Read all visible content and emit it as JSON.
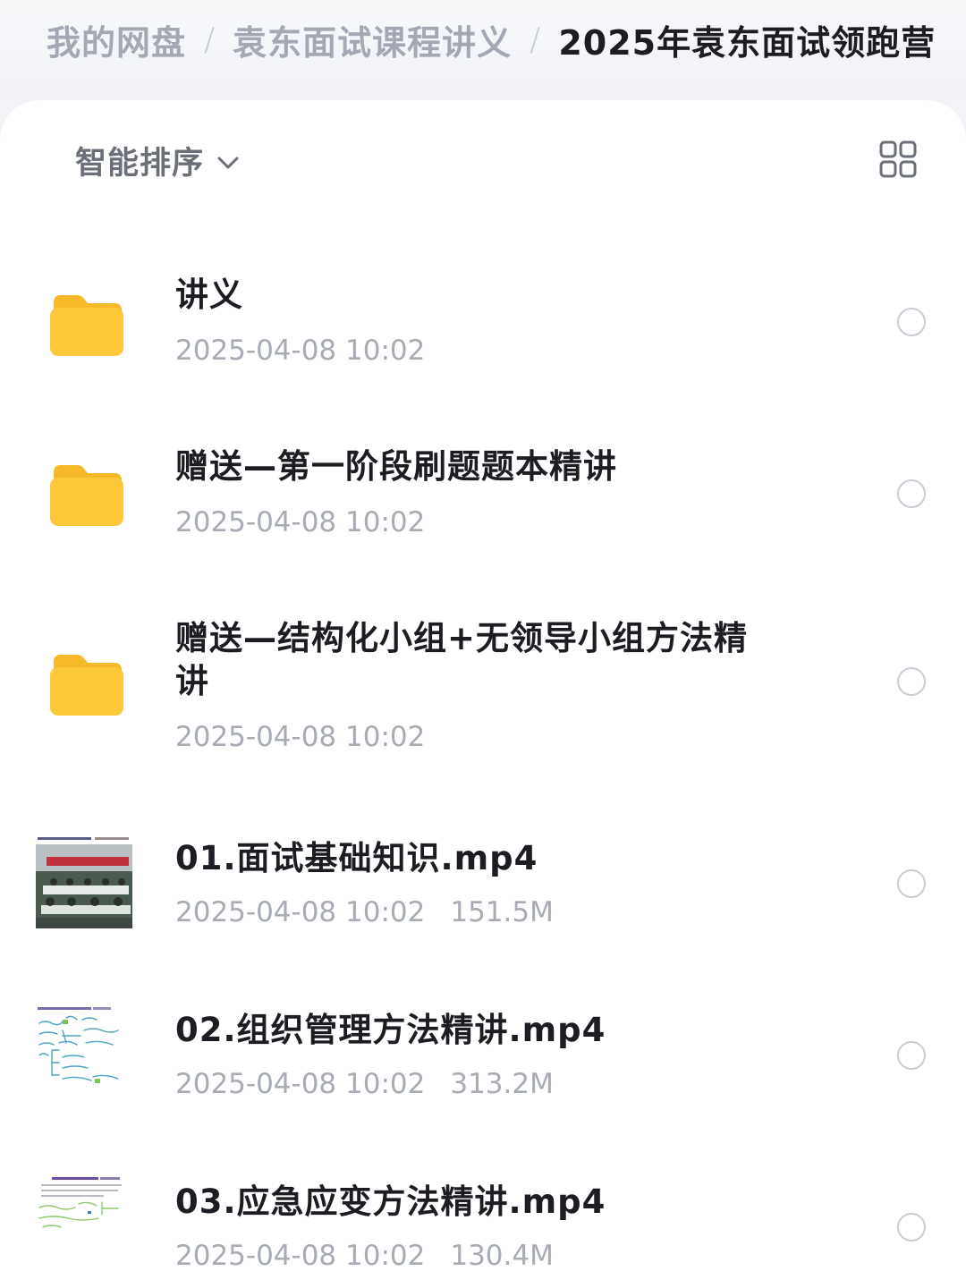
{
  "breadcrumb": {
    "items": [
      "我的网盘",
      "袁东面试课程讲义",
      "2025年袁东面试领跑营"
    ],
    "separator": "/"
  },
  "toolbar": {
    "sort_label": "智能排序",
    "sort_icon": "chevron-down-icon",
    "view_icon": "grid-view-icon"
  },
  "files": [
    {
      "type": "folder",
      "name": "讲义",
      "date": "2025-04-08 10:02",
      "size": ""
    },
    {
      "type": "folder",
      "name": "赠送—第一阶段刷题题本精讲",
      "date": "2025-04-08 10:02",
      "size": ""
    },
    {
      "type": "folder",
      "name": "赠送—结构化小组+无领导小组方法精讲",
      "date": "2025-04-08 10:02",
      "size": ""
    },
    {
      "type": "video",
      "name": "01.面试基础知识.mp4",
      "date": "2025-04-08 10:02",
      "size": "151.5M"
    },
    {
      "type": "video",
      "name": "02.组织管理方法精讲.mp4",
      "date": "2025-04-08 10:02",
      "size": "313.2M"
    },
    {
      "type": "video",
      "name": "03.应急应变方法精讲.mp4",
      "date": "2025-04-08 10:02",
      "size": "130.4M"
    }
  ],
  "colors": {
    "folder": "#fcc83a",
    "folder_tab": "#f5b92a",
    "text_primary": "#1c1d22",
    "text_secondary": "#a7abb4"
  }
}
